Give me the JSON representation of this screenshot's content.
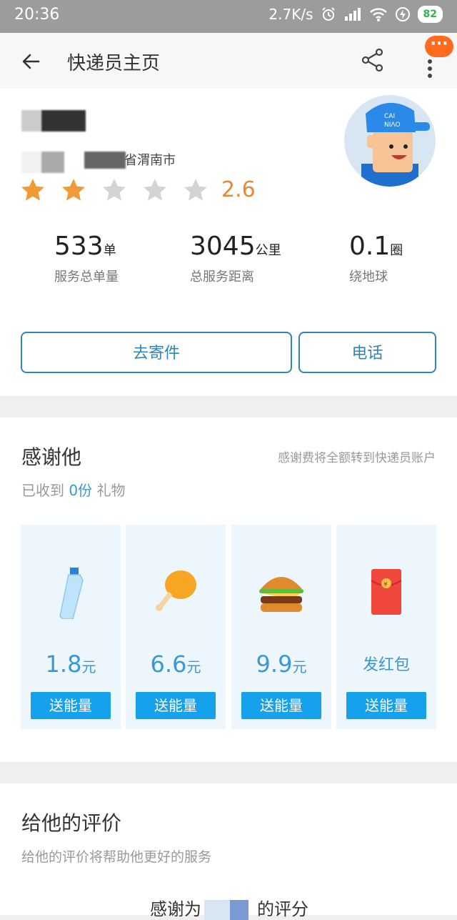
{
  "status_bar": {
    "time": "20:36",
    "speed": "2.7K/s",
    "battery": "82"
  },
  "header": {
    "title": "快递员主页"
  },
  "profile": {
    "location_suffix": "省渭南市",
    "rating": "2.6",
    "rating_stars": 2,
    "avatar_cap_text": "CAI NIAO",
    "stats": [
      {
        "value": "533",
        "unit": "单",
        "label": "服务总单量"
      },
      {
        "value": "3045",
        "unit": "公里",
        "label": "总服务距离"
      },
      {
        "value": "0.1",
        "unit": "圈",
        "label": "绕地球"
      }
    ],
    "actions": {
      "send": "去寄件",
      "call": "电话"
    }
  },
  "thanks": {
    "title": "感谢他",
    "note": "感谢费将全额转到快递员账户",
    "received_prefix": "已收到",
    "received_count": "0份",
    "received_suffix": "礼物",
    "gifts": [
      {
        "price": "1.8",
        "unit": "元",
        "icon": "water-bottle-icon",
        "button": "送能量"
      },
      {
        "price": "6.6",
        "unit": "元",
        "icon": "chicken-leg-icon",
        "button": "送能量"
      },
      {
        "price": "9.9",
        "unit": "元",
        "icon": "burger-icon",
        "button": "送能量"
      },
      {
        "label": "发红包",
        "icon": "red-envelope-icon",
        "button": "送能量"
      }
    ]
  },
  "review": {
    "title": "给他的评价",
    "subtitle": "给他的评价将帮助他更好的服务",
    "thanks_prefix": "感谢为",
    "thanks_suffix": "的评分"
  },
  "colors": {
    "accent": "#2f85b7",
    "gift_button": "#15a1eb",
    "rating": "#e58a35",
    "badge": "#ff6a1f"
  }
}
